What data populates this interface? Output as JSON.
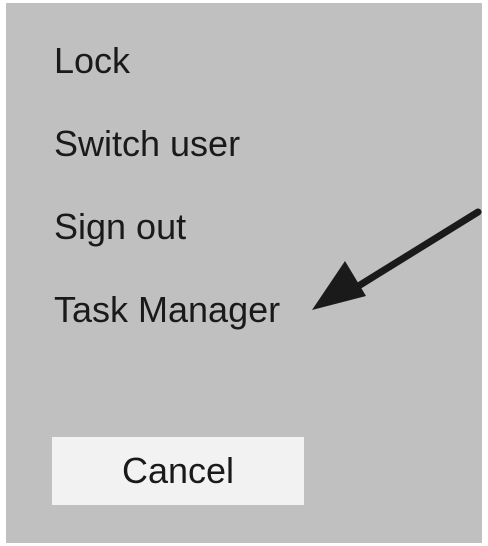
{
  "menu": {
    "items": [
      {
        "label": "Lock"
      },
      {
        "label": "Switch user"
      },
      {
        "label": "Sign out"
      },
      {
        "label": "Task Manager"
      }
    ],
    "cancel_label": "Cancel"
  },
  "annotation": {
    "icon": "arrow-icon",
    "color": "#1a1a1a",
    "points_to": "Task Manager"
  },
  "colors": {
    "panel_background": "#c0c0c0",
    "button_background": "#f2f2f2",
    "text": "#1a1a1a"
  }
}
